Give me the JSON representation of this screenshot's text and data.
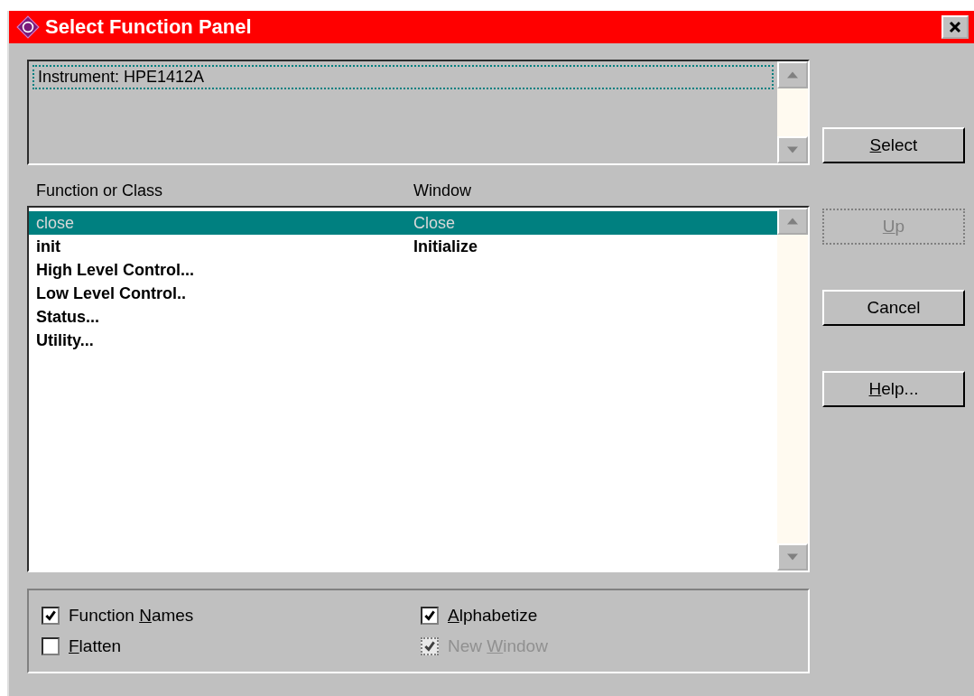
{
  "window": {
    "title": "Select Function Panel"
  },
  "instrument_list": {
    "items": [
      {
        "label": "Instrument:  HPE1412A",
        "selected": true
      }
    ]
  },
  "function_list": {
    "columns": [
      "Function or Class",
      "Window"
    ],
    "rows": [
      {
        "function": "close",
        "window": "Close",
        "selected": true
      },
      {
        "function": "init",
        "window": "Initialize",
        "selected": false
      },
      {
        "function": "High Level Control...",
        "selected": false
      },
      {
        "function": "Low Level Control..",
        "selected": false
      },
      {
        "function": "Status...",
        "selected": false
      },
      {
        "function": "Utility...",
        "selected": false
      }
    ]
  },
  "buttons": [
    {
      "access_key": "S",
      "label_after": "elect",
      "disabled": false
    },
    {
      "access_key": "U",
      "label_after": "p",
      "disabled": true
    },
    {
      "label_before": "Cancel",
      "disabled": false
    },
    {
      "access_key": "H",
      "label_after": "elp...",
      "disabled": false
    }
  ],
  "options": [
    {
      "label_before": "Function ",
      "access_key": "N",
      "label_after": "ames",
      "checked": true,
      "disabled": false
    },
    {
      "access_key": "A",
      "label_after": "lphabetize",
      "checked": true,
      "disabled": false
    },
    {
      "access_key": "F",
      "label_after": "latten",
      "checked": false,
      "disabled": false
    },
    {
      "label_before": "New ",
      "access_key": "W",
      "label_after": "indow",
      "checked": true,
      "disabled": true
    }
  ]
}
